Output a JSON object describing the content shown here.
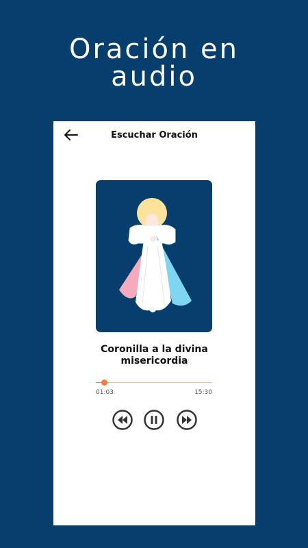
{
  "promo": {
    "title_line1": "Oración en",
    "title_line2": "audio"
  },
  "screen": {
    "title": "Escuchar Oración"
  },
  "player": {
    "track_title": "Coronilla a la divina misericordia",
    "elapsed": "01:03",
    "total": "15:30",
    "progress": 0.07
  },
  "icons": {
    "back": "arrow-left-icon",
    "rewind": "rewind-icon",
    "pause": "pause-icon",
    "forward": "fast-forward-icon"
  },
  "colors": {
    "background": "#063f6e",
    "accent": "#f07e3b",
    "ray_pink": "#f7a9bd",
    "ray_blue": "#7fd6f3",
    "halo": "#fbe39c"
  }
}
